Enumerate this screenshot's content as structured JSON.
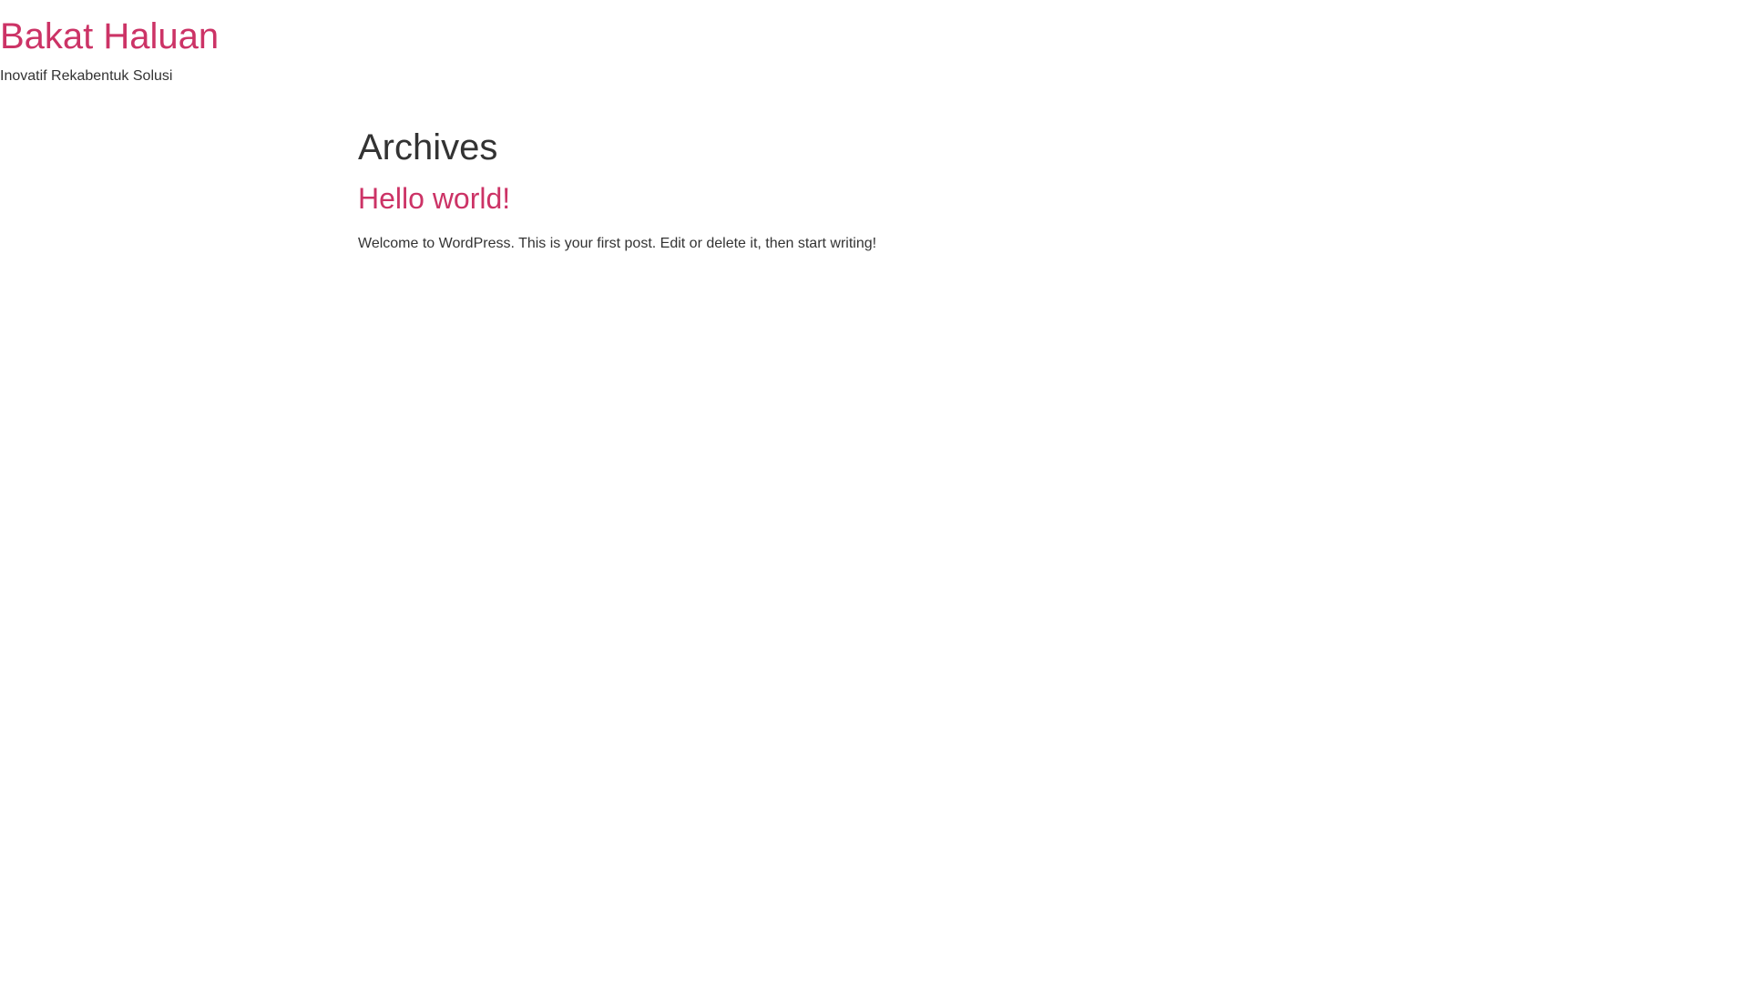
{
  "header": {
    "site_title": "Bakat Haluan",
    "tagline": "Inovatif Rekabentuk Solusi"
  },
  "main": {
    "page_title": "Archives",
    "posts": [
      {
        "title": "Hello world!",
        "excerpt": "Welcome to WordPress. This is your first post. Edit or delete it, then start writing!"
      }
    ]
  },
  "colors": {
    "accent": "#cc3366",
    "text": "#333333",
    "background": "#ffffff"
  }
}
